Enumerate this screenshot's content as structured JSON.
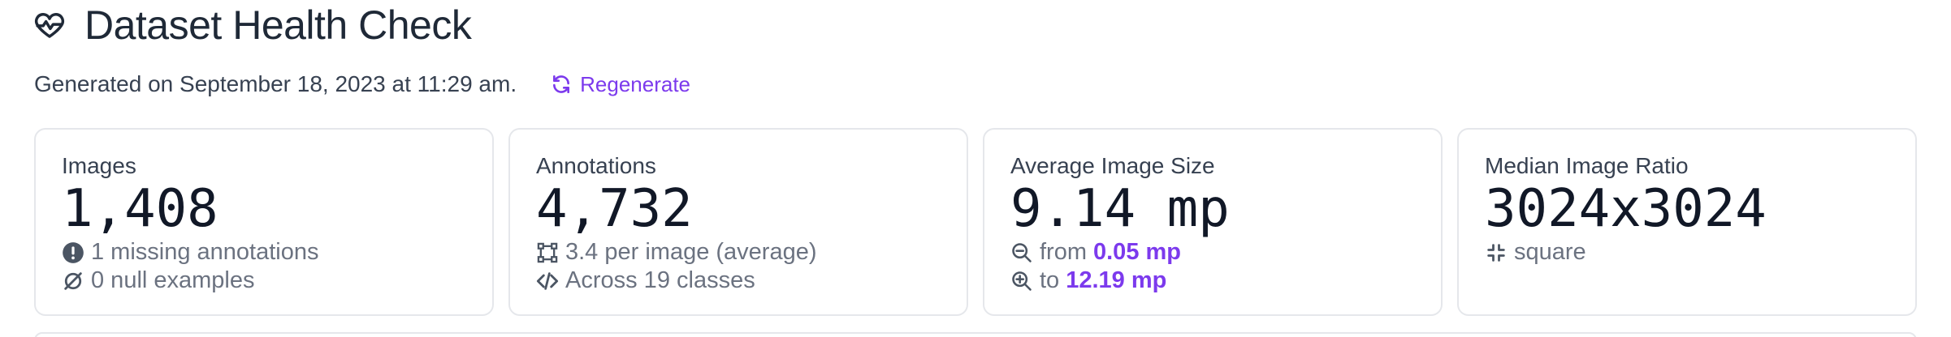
{
  "header": {
    "title": "Dataset Health Check",
    "icon": "heartbeat-icon"
  },
  "generated": {
    "text": "Generated on September 18, 2023 at 11:29 am.",
    "regenerate_label": "Regenerate"
  },
  "cards": {
    "images": {
      "label": "Images",
      "value": "1,408",
      "line1": "1 missing annotations",
      "line2": "0 null examples"
    },
    "annotations": {
      "label": "Annotations",
      "value": "4,732",
      "line1": "3.4 per image (average)",
      "line2": "Across 19 classes"
    },
    "avg_size": {
      "label": "Average Image Size",
      "value": "9.14 mp",
      "from_prefix": "from",
      "from_value": "0.05 mp",
      "to_prefix": "to",
      "to_value": "12.19 mp"
    },
    "median_ratio": {
      "label": "Median Image Ratio",
      "value": "3024x3024",
      "line1": "square"
    }
  },
  "colors": {
    "accent": "#7c3aed",
    "text": "#1f2937",
    "muted": "#6b7280",
    "border": "#e5e7eb"
  }
}
